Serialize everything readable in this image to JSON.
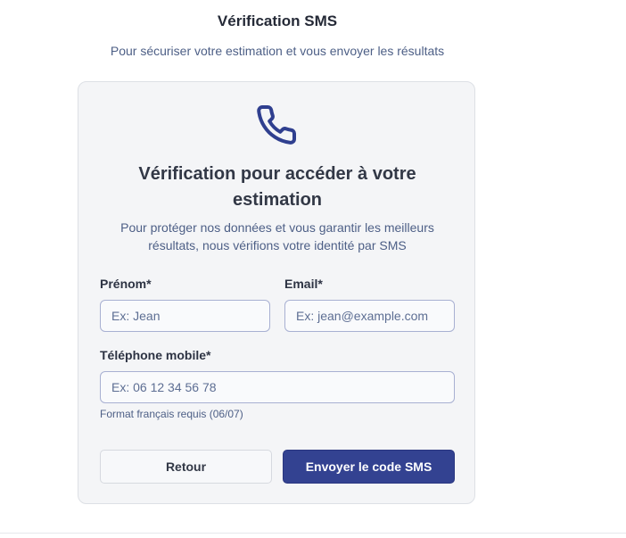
{
  "header": {
    "title": "Vérification SMS",
    "subtitle": "Pour sécuriser votre estimation et vous envoyer les résultats"
  },
  "card": {
    "icon": "phone-icon",
    "title": "Vérification pour accéder à votre estimation",
    "description": "Pour protéger nos données et vous garantir les meilleurs résultats, nous vérifions votre identité par SMS"
  },
  "form": {
    "first_name": {
      "label": "Prénom*",
      "value": "",
      "placeholder": "Ex: Jean"
    },
    "email": {
      "label": "Email*",
      "value": "",
      "placeholder": "Ex: jean@example.com"
    },
    "phone": {
      "label": "Téléphone mobile*",
      "value": "",
      "placeholder": "Ex: 06 12 34 56 78",
      "hint": "Format français requis (06/07)"
    }
  },
  "buttons": {
    "back_label": "Retour",
    "send_label": "Envoyer le code SMS"
  },
  "colors": {
    "accent": "#334291",
    "icon": "#2f3f8f",
    "muted_text": "#4d5f86",
    "card_background": "#f4f5f7",
    "input_border": "#a8b0d2"
  }
}
